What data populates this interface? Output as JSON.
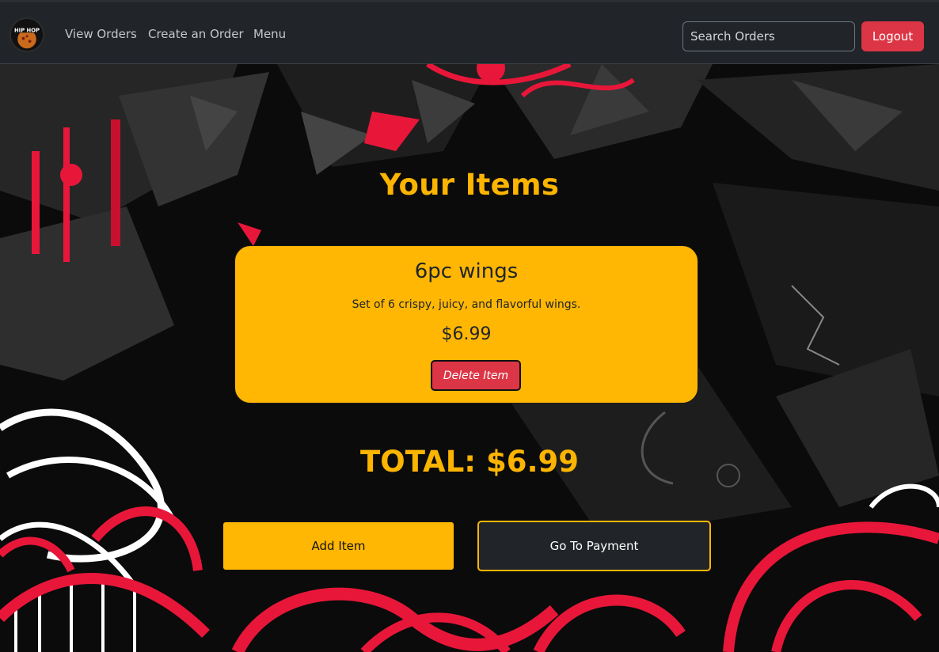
{
  "navbar": {
    "logo_text": "HIP HOP PIZZA AND WINGS",
    "links": [
      "View Orders",
      "Create an Order",
      "Menu"
    ],
    "search_placeholder": "Search Orders",
    "logout_label": "Logout"
  },
  "main": {
    "heading": "Your Items",
    "items": [
      {
        "name": "6pc wings",
        "description": "Set of 6 crispy, juicy, and flavorful wings.",
        "price": "$6.99",
        "delete_label": "Delete Item"
      }
    ],
    "total": "TOTAL: $6.99",
    "add_item_label": "Add Item",
    "payment_label": "Go To Payment"
  },
  "colors": {
    "navbar_bg": "#212529",
    "accent": "#ffb703",
    "heading": "#fbb400",
    "danger": "#dc3545",
    "graffiti_red": "#e8173a"
  },
  "icons": [
    "logo-icon"
  ]
}
